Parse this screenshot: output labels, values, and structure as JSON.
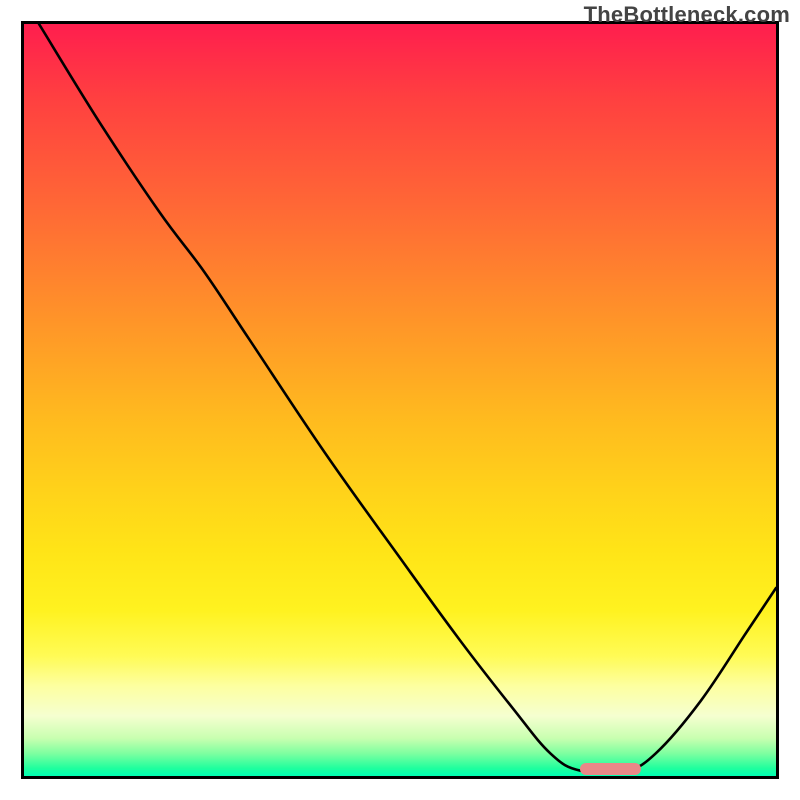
{
  "watermark": "TheBottleneck.com",
  "chart_data": {
    "type": "line",
    "title": "",
    "xlabel": "",
    "ylabel": "",
    "xlim": [
      0,
      100
    ],
    "ylim": [
      0,
      100
    ],
    "series": [
      {
        "name": "curve",
        "points": [
          {
            "x": 2,
            "y": 100
          },
          {
            "x": 10,
            "y": 87
          },
          {
            "x": 18,
            "y": 75
          },
          {
            "x": 24,
            "y": 67
          },
          {
            "x": 30,
            "y": 58
          },
          {
            "x": 40,
            "y": 43
          },
          {
            "x": 50,
            "y": 29
          },
          {
            "x": 58,
            "y": 18
          },
          {
            "x": 65,
            "y": 9
          },
          {
            "x": 70,
            "y": 3
          },
          {
            "x": 74,
            "y": 0.7
          },
          {
            "x": 80,
            "y": 0.7
          },
          {
            "x": 84,
            "y": 3
          },
          {
            "x": 90,
            "y": 10
          },
          {
            "x": 96,
            "y": 19
          },
          {
            "x": 100,
            "y": 25
          }
        ]
      }
    ],
    "marker": {
      "x_start": 74,
      "x_end": 82,
      "y": 0.9,
      "color": "#e98888"
    },
    "background_gradient": {
      "stops": [
        {
          "pos": 0,
          "color": "#ff1e4e"
        },
        {
          "pos": 25,
          "color": "#ff6a35"
        },
        {
          "pos": 52,
          "color": "#ffb91f"
        },
        {
          "pos": 78,
          "color": "#fff220"
        },
        {
          "pos": 92,
          "color": "#f5ffd0"
        },
        {
          "pos": 100,
          "color": "#00ffb4"
        }
      ]
    }
  }
}
